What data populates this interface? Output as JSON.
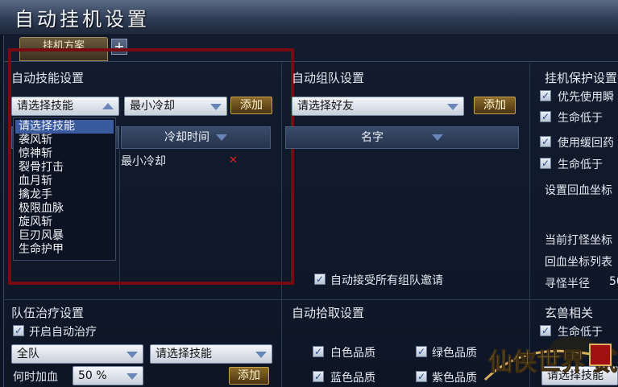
{
  "window": {
    "title": "自动挂机设置"
  },
  "tabs": {
    "active_label": "挂机方案",
    "add_label": "+"
  },
  "skill": {
    "section_title": "自动技能设置",
    "skill_select": "请选择技能",
    "cooldown_select": "最小冷却",
    "add_label": "添加",
    "col_name": "名字",
    "col_cooldown": "冷却时间",
    "row_cooldown": "最小冷却",
    "dropdown": [
      "请选择技能",
      "袭风斩",
      "惊神斩",
      "裂骨打击",
      "血月斩",
      "擒龙手",
      "极限血脉",
      "旋风斩",
      "巨刃风暴",
      "生命护甲"
    ]
  },
  "team": {
    "section_title": "自动组队设置",
    "friend_select": "请选择好友",
    "add_label": "添加",
    "col_name": "名字",
    "auto_accept": "自动接受所有组队邀请"
  },
  "protect": {
    "section_title": "挂机保护设置",
    "opt1": "优先使用瞬",
    "opt2": "生命低于",
    "opt3": "使用缓回药",
    "opt4": "生命低于",
    "return_coord": "设置回血坐标",
    "current_coord": "当前打怪坐标",
    "coord_list": "回血坐标列表",
    "radius_label": "寻怪半径",
    "radius_value": "50"
  },
  "heal": {
    "section_title": "队伍治疗设置",
    "enable": "开启自动治疗",
    "target_select": "全队",
    "skill_select": "请选择技能",
    "when_label": "何时加血",
    "percent_select": "50 %",
    "add_label": "添加"
  },
  "pickup": {
    "section_title": "自动拾取设置",
    "white": "白色品质",
    "green": "绿色品质",
    "blue": "蓝色品质",
    "purple": "紫色品质"
  },
  "pet": {
    "section_title": "玄兽相关",
    "life_below": "生命低于",
    "skill_sel": "请选择技能"
  },
  "logo": {
    "text": "仙侠世界 贰"
  }
}
